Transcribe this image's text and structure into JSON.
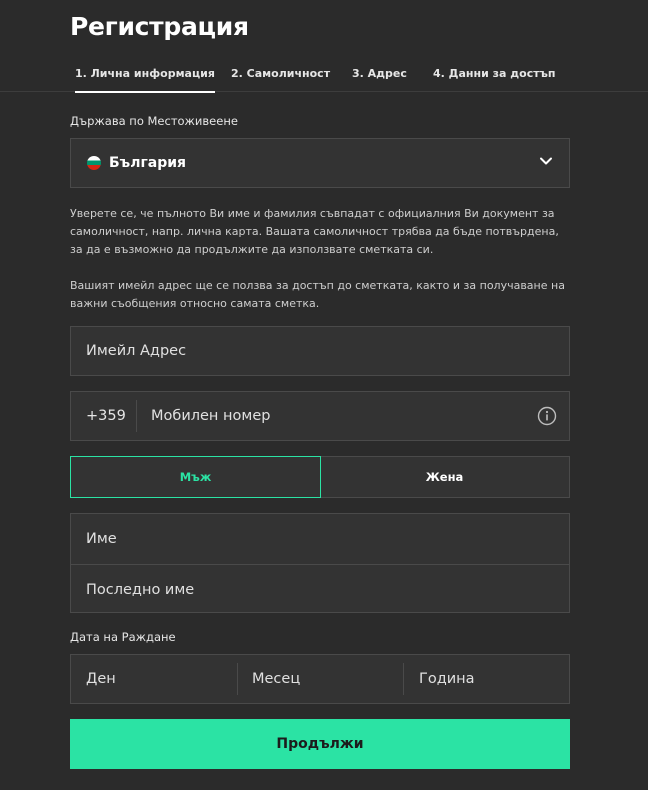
{
  "title": "Регистрация",
  "tabs": [
    {
      "label": "1. Лична информация",
      "active": true
    },
    {
      "label": "2. Самоличност"
    },
    {
      "label": "3. Адрес"
    },
    {
      "label": "4. Данни за достъп"
    }
  ],
  "country": {
    "label": "Държава по Местоживеене",
    "value": "България"
  },
  "info": {
    "identity": "Уверете се, че пълното Ви име и фамилия съвпадат с официалния Ви документ за самоличност, напр. лична карта. Вашата самоличност трябва да бъде потвърдена, за да е възможно да продължите да използвате сметката си.",
    "email": "Вашият имейл адрес ще се ползва за достъп до сметката, както и за получаване на важни съобщения относно самата сметка."
  },
  "email": {
    "placeholder": "Имейл Адрес"
  },
  "phone": {
    "prefix": "+359",
    "placeholder": "Мобилен номер"
  },
  "gender": {
    "male": "Мъж",
    "female": "Жена",
    "selected": "male"
  },
  "names": {
    "first_placeholder": "Име",
    "last_placeholder": "Последно име"
  },
  "dob": {
    "label": "Дата на Раждане",
    "day_placeholder": "Ден",
    "month_placeholder": "Месец",
    "year_placeholder": "Година"
  },
  "continue_label": "Продължи",
  "colors": {
    "accent": "#2be3a4",
    "background": "#2b2b2b",
    "field": "#333333"
  }
}
